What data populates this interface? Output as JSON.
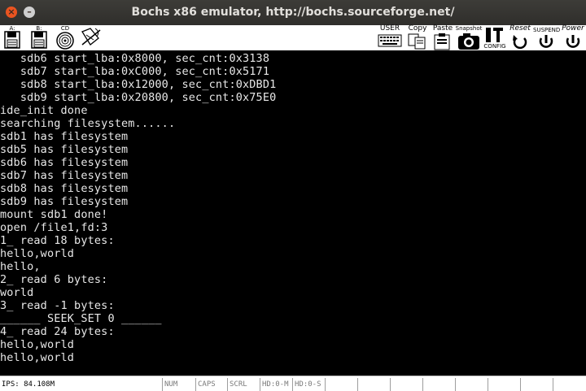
{
  "window": {
    "title": "Bochs x86 emulator, http://bochs.sourceforge.net/",
    "close_glyph": "×",
    "minimize_glyph": "–"
  },
  "toolbar": {
    "floppy_a_label": "A:",
    "floppy_b_label": "B:",
    "cdrom_label": "CD",
    "user_label": "USER",
    "copy_label": "Copy",
    "paste_label": "Paste",
    "snapshot_label": "Snapshot",
    "config_label": "CONFIG",
    "reset_label": "Reset",
    "suspend_label": "SUSPEND",
    "power_label": "Power",
    "icons": [
      "floppy-a-icon",
      "floppy-b-icon",
      "cdrom-icon",
      "mouse-icon",
      "user-icon",
      "copy-icon",
      "paste-icon",
      "snapshot-icon",
      "config-icon",
      "reset-icon",
      "suspend-icon",
      "power-icon"
    ]
  },
  "terminal": {
    "lines": [
      "   sdb6 start_lba:0x8000, sec_cnt:0x3138",
      "   sdb7 start_lba:0xC000, sec_cnt:0x5171",
      "   sdb8 start_lba:0x12000, sec_cnt:0xDBD1",
      "   sdb9 start_lba:0x20800, sec_cnt:0x75E0",
      "ide_init done",
      "searching filesystem......",
      "sdb1 has filesystem",
      "sdb5 has filesystem",
      "sdb6 has filesystem",
      "sdb7 has filesystem",
      "sdb8 has filesystem",
      "sdb9 has filesystem",
      "mount sdb1 done!",
      "open /file1,fd:3",
      "1_ read 18 bytes:",
      "hello,world",
      "hello,",
      "2_ read 6 bytes:",
      "world",
      "3_ read -1 bytes:",
      "______ SEEK_SET 0 ______",
      "4_ read 24 bytes:",
      "hello,world",
      "hello,world"
    ],
    "text_color": "#e8e8e8",
    "background": "#000000"
  },
  "statusbar": {
    "ips": "IPS: 84.108M",
    "num": "NUM",
    "caps": "CAPS",
    "scrl": "SCRL",
    "hd0m": "HD:0-M",
    "hd0s": "HD:0-S"
  },
  "colors": {
    "titlebar": "#3a3935",
    "close_button": "#e95420",
    "title_text": "#e1dfdb"
  }
}
